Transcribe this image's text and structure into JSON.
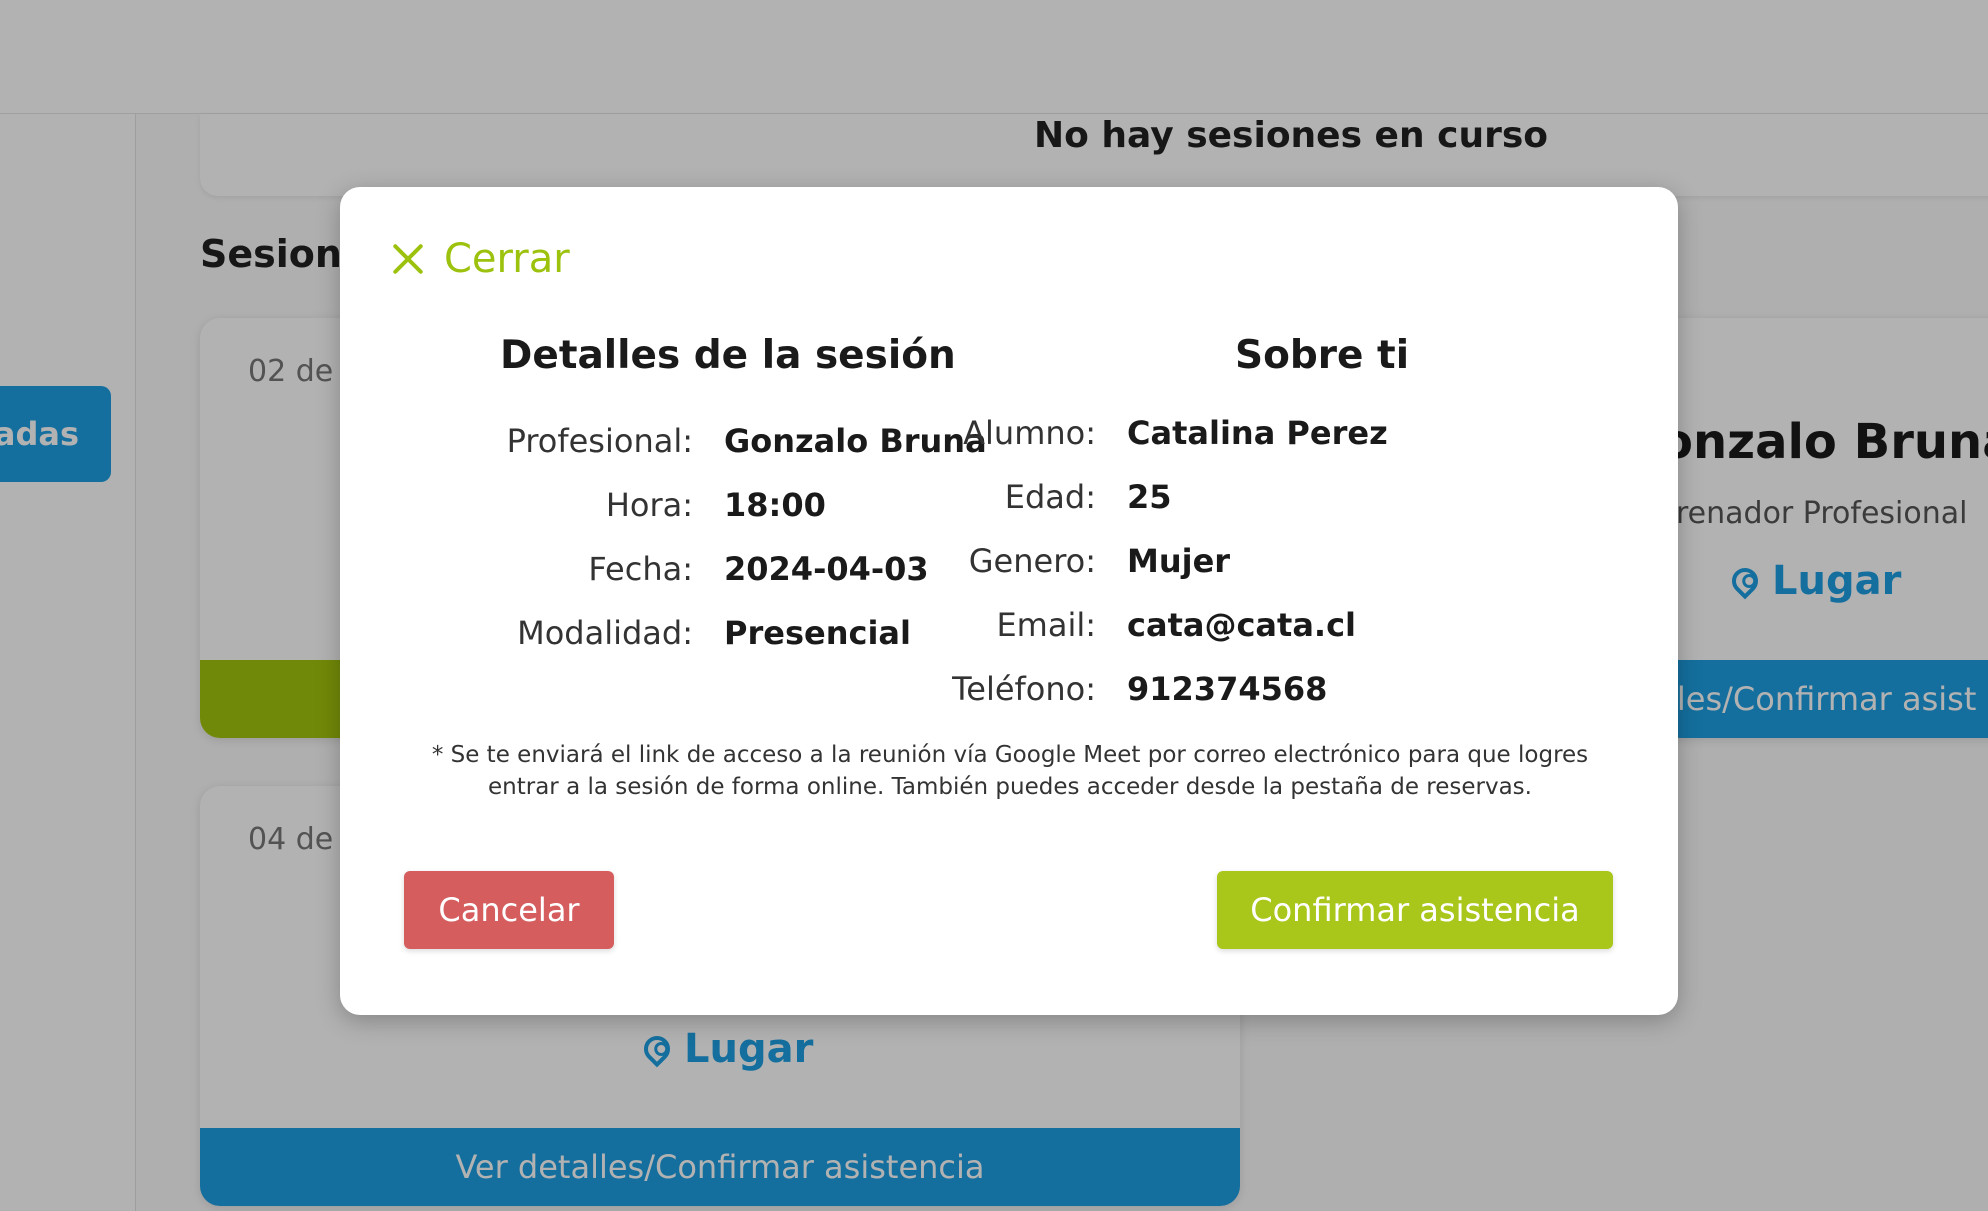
{
  "background": {
    "sidebar_tab_label": "adas",
    "current_sessions_text": "No hay sesiones en curso",
    "sessions_title": "Sesiones",
    "cards": [
      {
        "date": "02 de",
        "action_label": ""
      },
      {
        "date": "04 de",
        "place_label": "Lugar",
        "action_label": "Ver detalles/Confirmar asistencia"
      },
      {
        "professional": "onzalo Bruna",
        "role": "renador Profesional",
        "place_label": "Lugar",
        "action_label": "lles/Confirmar asist"
      }
    ]
  },
  "modal": {
    "close_label": "Cerrar",
    "session_details": {
      "title": "Detalles de la sesión",
      "fields": [
        {
          "label": "Profesional:",
          "value": "Gonzalo Bruna"
        },
        {
          "label": "Hora:",
          "value": "18:00"
        },
        {
          "label": "Fecha:",
          "value": "2024-04-03"
        },
        {
          "label": "Modalidad:",
          "value": "Presencial"
        }
      ]
    },
    "about_you": {
      "title": "Sobre ti",
      "fields": [
        {
          "label": "Alumno:",
          "value": "Catalina Perez"
        },
        {
          "label": "Edad:",
          "value": "25"
        },
        {
          "label": "Genero:",
          "value": "Mujer"
        },
        {
          "label": "Email:",
          "value": "cata@cata.cl"
        },
        {
          "label": "Teléfono:",
          "value": "912374568"
        }
      ]
    },
    "note": "* Se te enviará el link de acceso a la reunión vía Google Meet por correo electrónico para que logres entrar a la sesión de forma online. También puedes acceder desde la pestaña de reservas.",
    "cancel_label": "Cancelar",
    "confirm_label": "Confirmar asistencia"
  },
  "colors": {
    "accent_green": "#9cc20d",
    "confirm_green": "#a9c61a",
    "cancel_red": "#d55d5e",
    "brand_blue": "#1e9fe2"
  }
}
